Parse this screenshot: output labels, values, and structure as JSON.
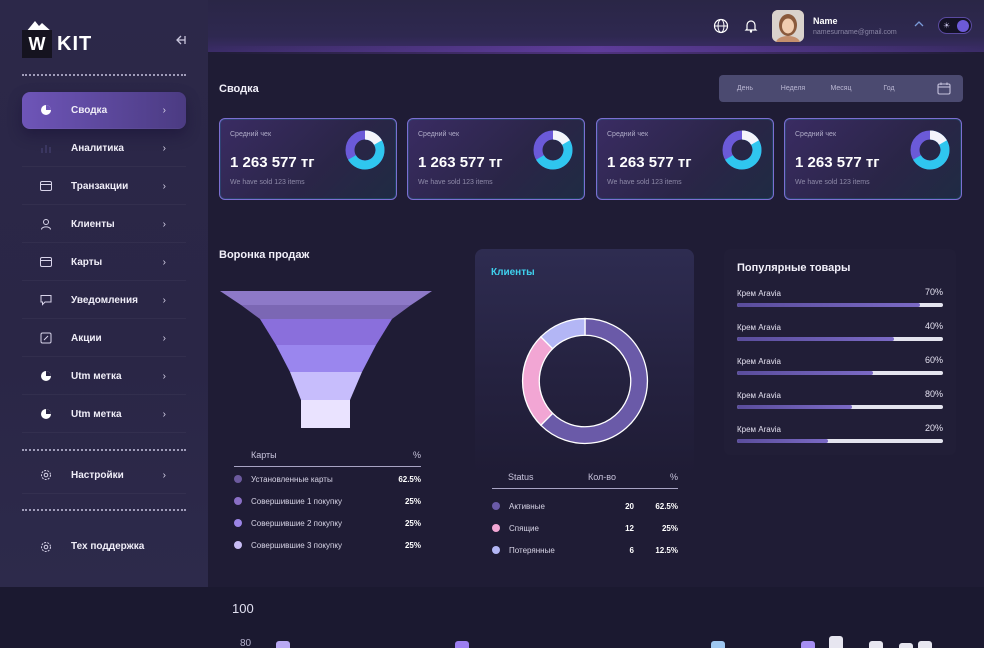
{
  "brand": {
    "logo_letter": "W",
    "name": "KIT"
  },
  "sidebar": {
    "items": [
      {
        "label": "Сводка",
        "icon": "pie-icon"
      },
      {
        "label": "Аналитика",
        "icon": "analytics-icon"
      },
      {
        "label": "Транзакции",
        "icon": "card-icon"
      },
      {
        "label": "Клиенты",
        "icon": "user-icon"
      },
      {
        "label": "Карты",
        "icon": "card-icon"
      },
      {
        "label": "Уведомления",
        "icon": "chat-icon"
      },
      {
        "label": "Акции",
        "icon": "edit-icon"
      },
      {
        "label": "Utm метка",
        "icon": "pie-icon"
      },
      {
        "label": "Utm метка",
        "icon": "pie-icon"
      }
    ],
    "settings_label": "Настройки",
    "support_label": "Тех поддержка"
  },
  "header": {
    "user_name": "Name",
    "user_email": "namesurname@gmail.com"
  },
  "summary": {
    "title": "Сводка",
    "periods": [
      "День",
      "Неделя",
      "Месяц",
      "Год"
    ],
    "cards": [
      {
        "label": "Средний чек",
        "value": "1 263 577 тг",
        "sub": "We have sold 123 items"
      },
      {
        "label": "Средний чек",
        "value": "1 263 577 тг",
        "sub": "We have sold 123 items"
      },
      {
        "label": "Средний чек",
        "value": "1 263 577 тг",
        "sub": "We have sold 123 items"
      },
      {
        "label": "Средний чек",
        "value": "1 263 577 тг",
        "sub": "We have sold 123 items"
      }
    ]
  },
  "funnel": {
    "title": "Воронка продаж",
    "col_name": "Карты",
    "col_pct": "%",
    "rows": [
      {
        "name": "Установленные карты",
        "pct": "62.5%",
        "color": "#6c5a9e"
      },
      {
        "name": "Совершившие 1 покупку",
        "pct": "25%",
        "color": "#8a6fc6"
      },
      {
        "name": "Совершившие 2 покупку",
        "pct": "25%",
        "color": "#9b84e6"
      },
      {
        "name": "Совершившие 3 покупку",
        "pct": "25%",
        "color": "#c9bdf5"
      }
    ]
  },
  "clients": {
    "title": "Клиенты",
    "col_status": "Status",
    "col_count": "Кол-во",
    "col_pct": "%",
    "rows": [
      {
        "status": "Активные",
        "count": "20",
        "pct": "62.5%",
        "color": "#6a5aa8"
      },
      {
        "status": "Спящие",
        "count": "12",
        "pct": "25%",
        "color": "#f2a6d4"
      },
      {
        "status": "Потерянные",
        "count": "6",
        "pct": "12.5%",
        "color": "#b3b6f5"
      }
    ],
    "chart_data": {
      "type": "pie",
      "categories": [
        "Активные",
        "Спящие",
        "Потерянные"
      ],
      "values": [
        62.5,
        25,
        12.5
      ]
    }
  },
  "popular": {
    "title": "Популярные товары",
    "items": [
      {
        "name": "Крем Aravia",
        "pct": "70%",
        "fill": 0.89
      },
      {
        "name": "Крем Aravia",
        "pct": "40%",
        "fill": 0.76
      },
      {
        "name": "Крем Aravia",
        "pct": "60%",
        "fill": 0.66
      },
      {
        "name": "Крем Aravia",
        "pct": "80%",
        "fill": 0.56
      },
      {
        "name": "Крем Aravia",
        "pct": "20%",
        "fill": 0.44
      }
    ]
  },
  "bottom_chart": {
    "tick_top": "100",
    "tick_next": "80"
  }
}
